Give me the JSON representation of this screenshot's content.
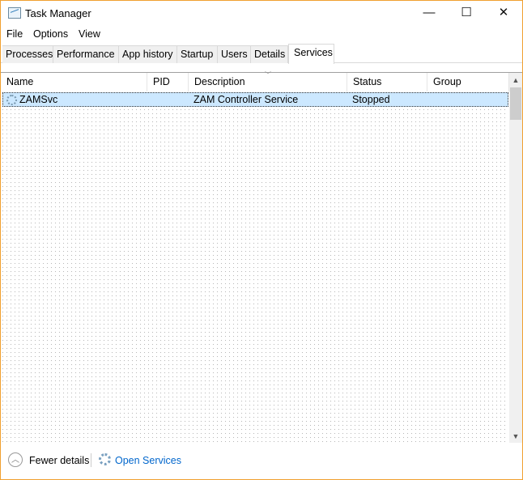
{
  "window": {
    "title": "Task Manager",
    "minimize": "—",
    "maximize": "☐",
    "close": "✕"
  },
  "menu": [
    "File",
    "Options",
    "View"
  ],
  "tabs": [
    "Processes",
    "Performance",
    "App history",
    "Startup",
    "Users",
    "Details",
    "Services"
  ],
  "active_tab": "Services",
  "columns": [
    "Name",
    "PID",
    "Description",
    "Status",
    "Group"
  ],
  "rows": [
    {
      "name": "ZAMSvc",
      "pid": "",
      "description": "ZAM Controller Service",
      "status": "Stopped",
      "group": ""
    }
  ],
  "footer": {
    "fewer_details": "Fewer details",
    "open_services": "Open Services"
  },
  "colors": {
    "selection": "#cce8ff",
    "link": "#0066cc",
    "border": "#f0a030"
  }
}
